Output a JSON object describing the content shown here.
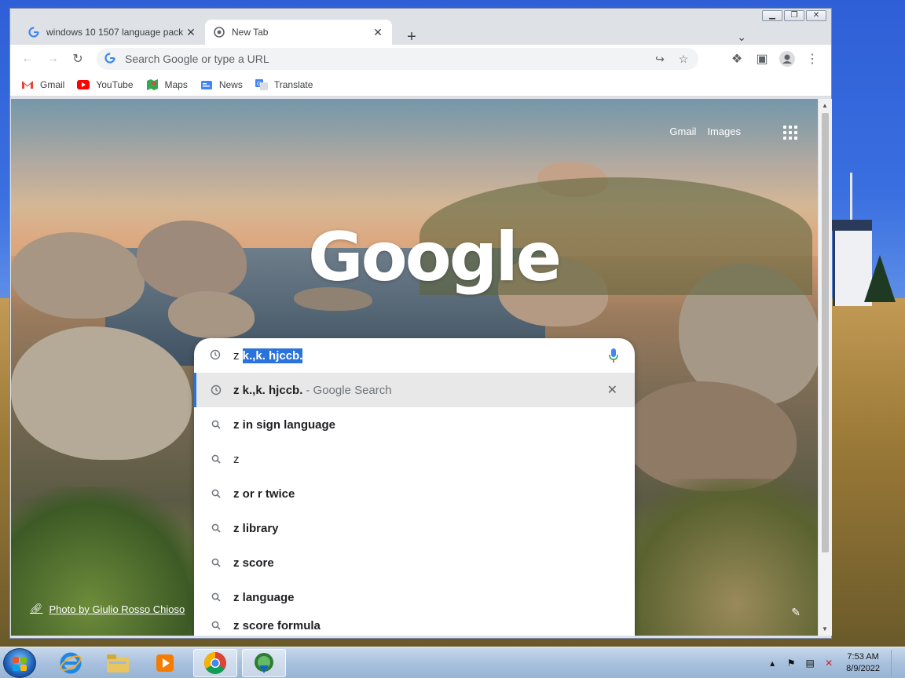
{
  "browser": {
    "tabs": [
      {
        "title": "windows 10 1507 language pack",
        "favicon": "google-g-icon",
        "active": false
      },
      {
        "title": "New Tab",
        "favicon": "chrome-icon",
        "active": true
      }
    ],
    "new_tab_label": "+",
    "window_controls": [
      "minimize",
      "restore",
      "close"
    ]
  },
  "toolbar": {
    "back": "back-arrow-icon",
    "forward": "forward-arrow-icon",
    "reload": "reload-icon",
    "omnibox_placeholder": "Search Google or type a URL",
    "share": "share-icon",
    "bookmark": "star-icon",
    "extensions": "puzzle-icon",
    "side_panel": "side-panel-icon",
    "profile": "profile-icon",
    "menu": "kebab-menu-icon"
  },
  "bookmarks": [
    {
      "label": "Gmail",
      "icon": "gmail-icon"
    },
    {
      "label": "YouTube",
      "icon": "youtube-icon"
    },
    {
      "label": "Maps",
      "icon": "maps-icon"
    },
    {
      "label": "News",
      "icon": "news-icon"
    },
    {
      "label": "Translate",
      "icon": "translate-icon"
    }
  ],
  "newtab": {
    "links": {
      "gmail": "Gmail",
      "images": "Images"
    },
    "logo": "Google",
    "photo_credit": "Photo by Giulio Rosso Chioso",
    "search": {
      "typed": "z ",
      "selected": "k.,k. hjccb.",
      "suggestions": [
        {
          "bold": "z k.,k. hjccb.",
          "extra": " - Google Search",
          "icon": "history-icon",
          "removable": true,
          "highlighted": true
        },
        {
          "bold": "z in sign language",
          "extra": "",
          "icon": "search-icon"
        },
        {
          "bold": "z",
          "extra": "",
          "icon": "search-icon"
        },
        {
          "bold": "z or r twice",
          "extra": "",
          "icon": "search-icon"
        },
        {
          "bold": "z library",
          "extra": "",
          "icon": "search-icon"
        },
        {
          "bold": "z score",
          "extra": "",
          "icon": "search-icon"
        },
        {
          "bold": "z language",
          "extra": "",
          "icon": "search-icon"
        },
        {
          "bold": "z score formula",
          "extra": "",
          "icon": "search-icon"
        }
      ]
    }
  },
  "taskbar": {
    "apps": [
      "start-orb",
      "internet-explorer-icon",
      "file-explorer-icon",
      "media-player-icon",
      "chrome-icon",
      "idm-icon"
    ],
    "time": "7:53 AM",
    "date": "8/9/2022"
  },
  "colors": {
    "accent": "#2a73dc",
    "tab_bg": "#dee1e6",
    "taskbar": "#a8c1de"
  }
}
